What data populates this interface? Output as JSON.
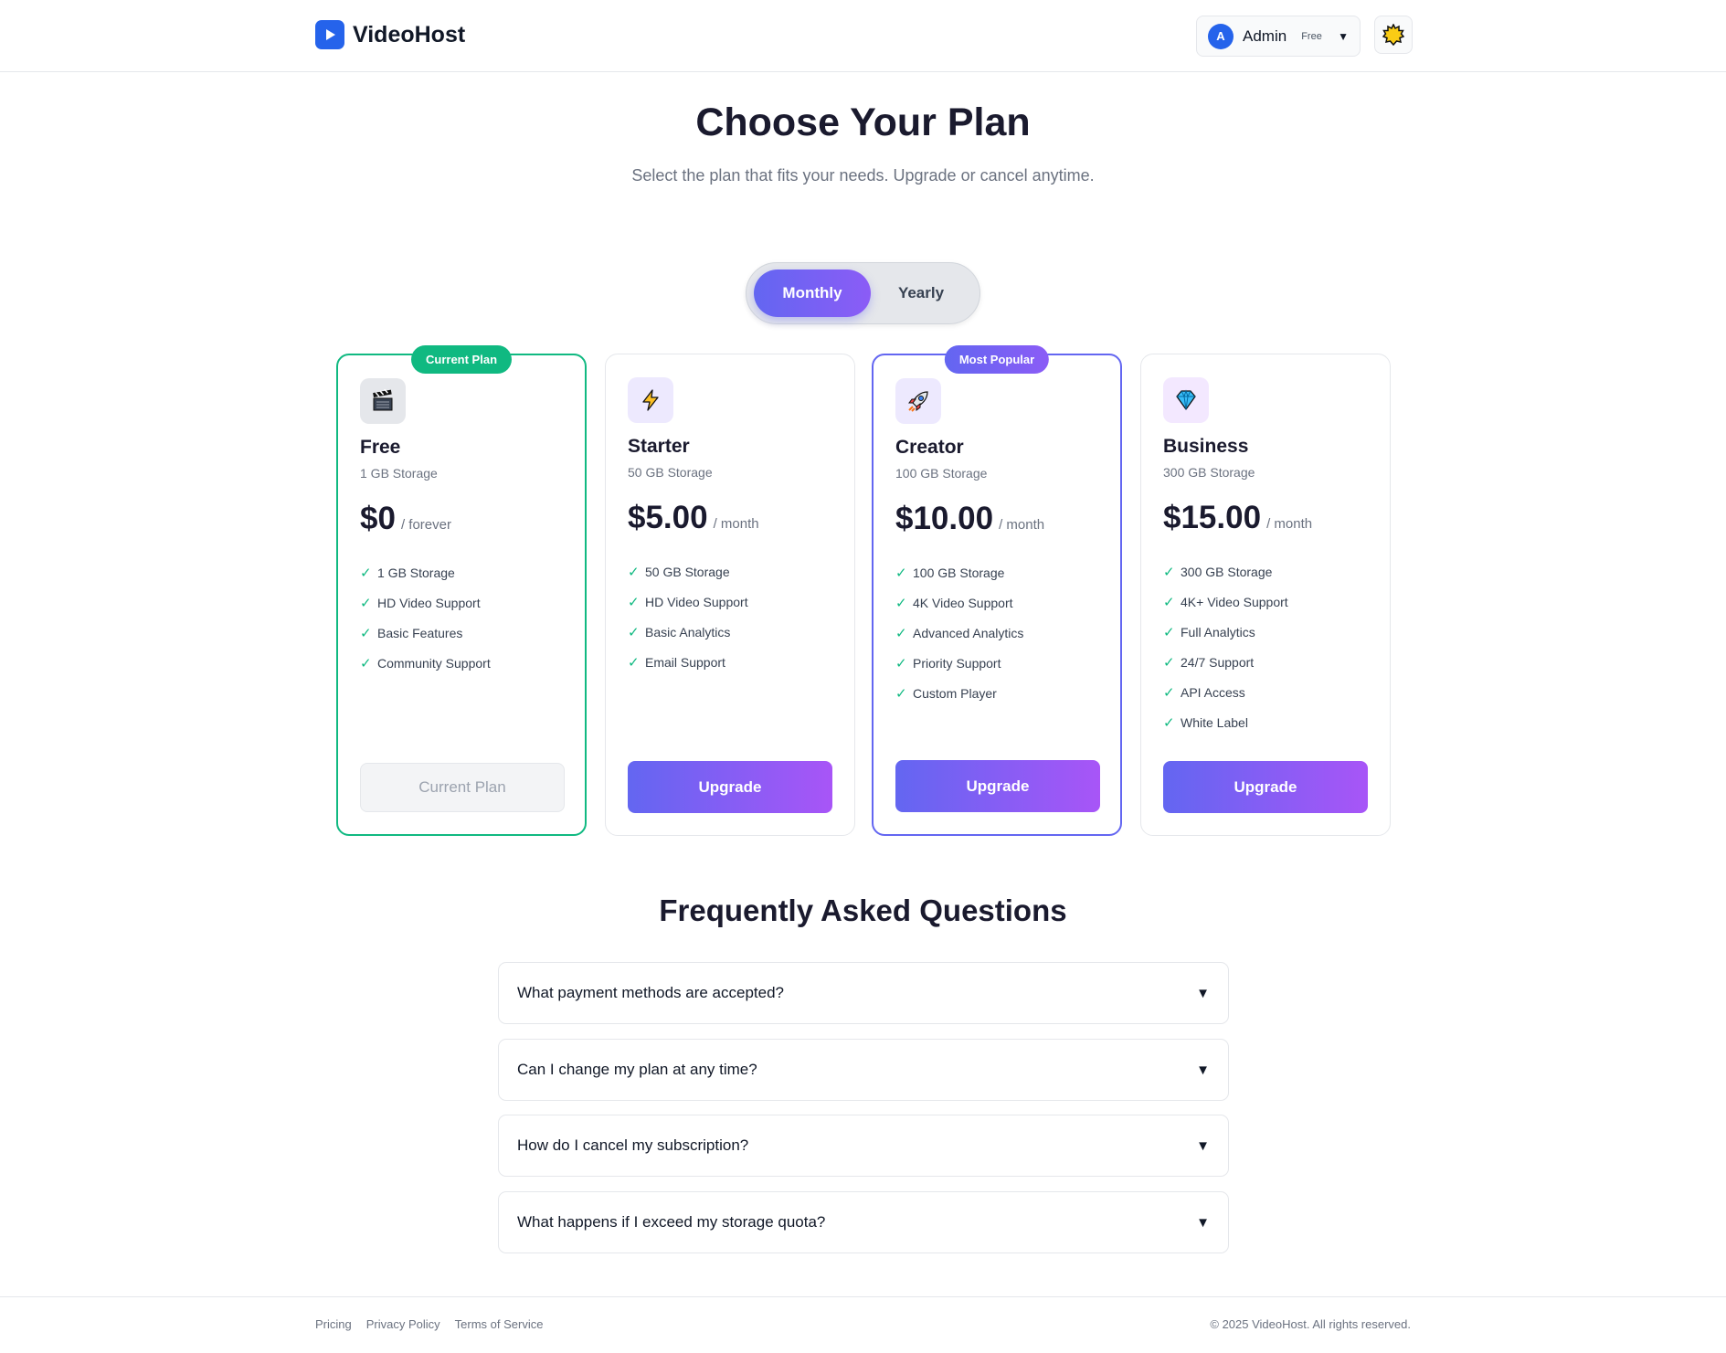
{
  "brand": {
    "name": "VideoHost",
    "accent": "#2563eb"
  },
  "user": {
    "initial": "A",
    "name": "Admin",
    "tier": "Free"
  },
  "hero": {
    "title": "Choose Your Plan",
    "subtitle": "Select the plan that fits your needs. Upgrade or cancel anytime."
  },
  "billing_toggle": {
    "options": [
      "Monthly",
      "Yearly"
    ],
    "selected": "Monthly"
  },
  "plans": [
    {
      "name": "Free",
      "icon": "clapperboard-icon",
      "storage": "1 GB Storage",
      "price": "$0",
      "period": "/ forever",
      "badge": "Current Plan",
      "features": [
        "1 GB Storage",
        "HD Video Support",
        "Basic Features",
        "Community Support"
      ],
      "cta": "Current Plan"
    },
    {
      "name": "Starter",
      "icon": "lightning-icon",
      "storage": "50 GB Storage",
      "price": "$5.00",
      "period": "/ month",
      "features": [
        "50 GB Storage",
        "HD Video Support",
        "Basic Analytics",
        "Email Support"
      ],
      "cta": "Upgrade"
    },
    {
      "name": "Creator",
      "icon": "rocket-icon",
      "storage": "100 GB Storage",
      "price": "$10.00",
      "period": "/ month",
      "badge": "Most Popular",
      "features": [
        "100 GB Storage",
        "4K Video Support",
        "Advanced Analytics",
        "Priority Support",
        "Custom Player"
      ],
      "cta": "Upgrade"
    },
    {
      "name": "Business",
      "icon": "diamond-icon",
      "storage": "300 GB Storage",
      "price": "$15.00",
      "period": "/ month",
      "features": [
        "300 GB Storage",
        "4K+ Video Support",
        "Full Analytics",
        "24/7 Support",
        "API Access",
        "White Label"
      ],
      "cta": "Upgrade"
    }
  ],
  "faq": {
    "title": "Frequently Asked Questions",
    "items": [
      "What payment methods are accepted?",
      "Can I change my plan at any time?",
      "How do I cancel my subscription?",
      "What happens if I exceed my storage quota?"
    ]
  },
  "footer": {
    "links": [
      "Pricing",
      "Privacy Policy",
      "Terms of Service"
    ],
    "copyright": "© 2025 VideoHost. All rights reserved."
  },
  "colors": {
    "current": "#10b981",
    "popular": "#6366f1",
    "gradient_start": "#6366f1",
    "gradient_end": "#a855f7"
  }
}
